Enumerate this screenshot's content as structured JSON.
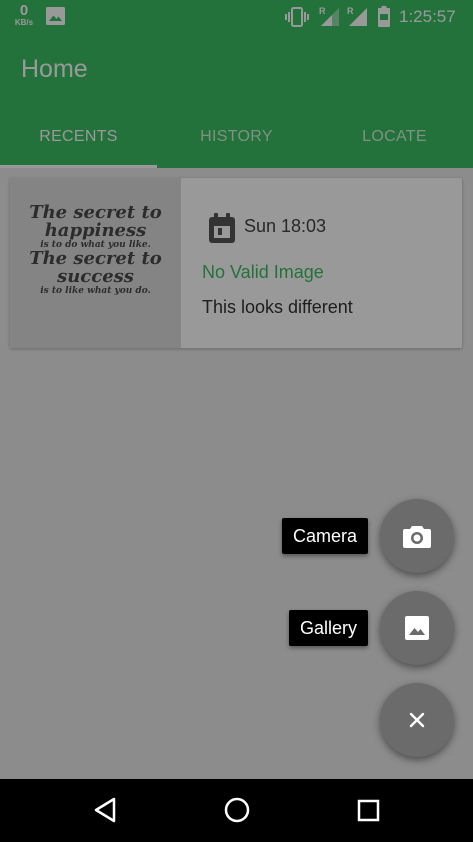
{
  "status_bar": {
    "speed_value": "0",
    "speed_unit": "KB/s",
    "time": "1:25:57",
    "icons": [
      "image-icon",
      "vibrate-icon",
      "signal-roaming-icon",
      "signal-roaming-icon",
      "battery-icon"
    ]
  },
  "app_bar": {
    "title": "Home",
    "tabs": [
      {
        "label": "RECENTS",
        "active": true
      },
      {
        "label": "HISTORY",
        "active": false
      },
      {
        "label": "LOCATE",
        "active": false
      }
    ]
  },
  "card": {
    "thumbnail_quote": {
      "line1": "The secret to",
      "line2": "happiness",
      "line3": "is to do what you like.",
      "line4": "The secret to",
      "line5": "success",
      "line6": "is to like what you do."
    },
    "time": "Sun 18:03",
    "status": "No Valid Image",
    "description": "This looks different"
  },
  "fab_menu": {
    "camera_label": "Camera",
    "gallery_label": "Gallery",
    "icons": [
      "camera-icon",
      "image-icon",
      "close-icon"
    ]
  },
  "nav_bar": {
    "icons": [
      "back-icon",
      "home-icon",
      "recents-icon"
    ]
  },
  "colors": {
    "primary": "#3bbf63",
    "fab": "#6b6b6b"
  }
}
